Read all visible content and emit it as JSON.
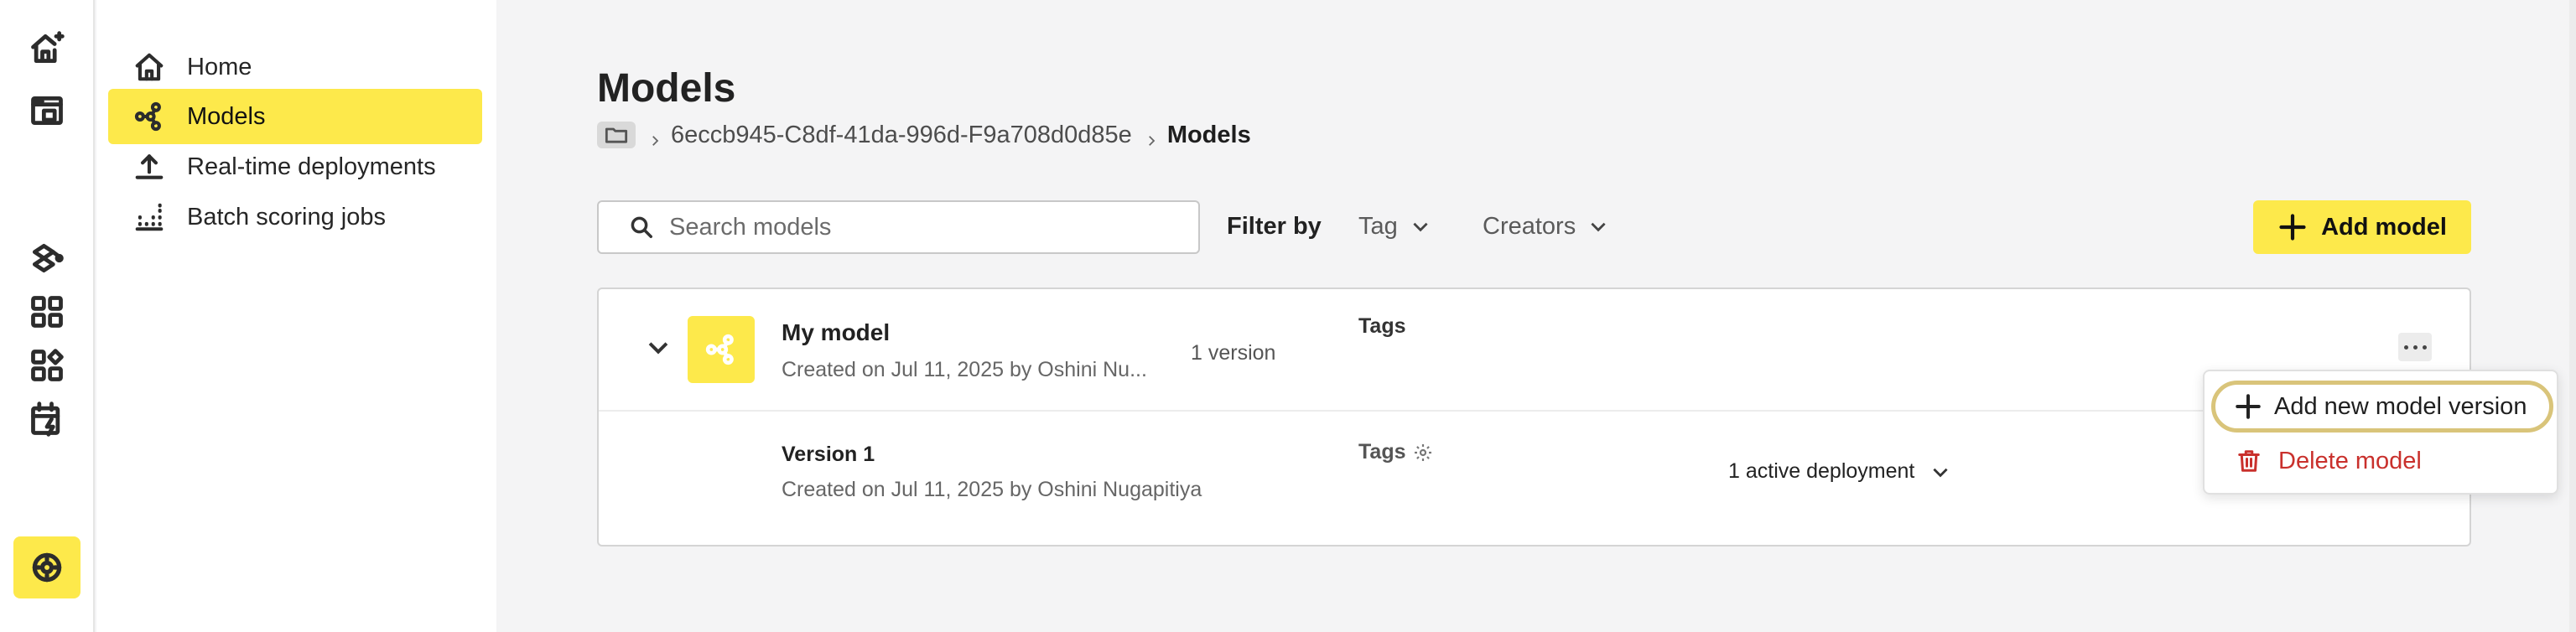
{
  "rail": {
    "icons": [
      "house-sparkle-icon",
      "store-icon",
      "puzzle-network-icon",
      "apps-grid-icon",
      "apps-add-icon",
      "calendar-bolt-icon"
    ],
    "bottom_icon": "brain-circuit-icon",
    "accent": "#fde94b"
  },
  "sidebar": {
    "items": [
      {
        "label": "Home",
        "icon": "home-icon"
      },
      {
        "label": "Models",
        "icon": "model-graph-icon",
        "active": true
      },
      {
        "label": "Real-time deployments",
        "icon": "upload-icon"
      },
      {
        "label": "Batch scoring jobs",
        "icon": "batch-grid-icon"
      }
    ]
  },
  "main": {
    "title": "Models",
    "breadcrumb": {
      "folder_icon": "folder-icon",
      "project": "6eccb945-C8df-41da-996d-F9a708d0d85e",
      "current": "Models"
    },
    "search": {
      "placeholder": "Search models",
      "value": ""
    },
    "filter": {
      "label": "Filter by",
      "tag": "Tag",
      "creators": "Creators"
    },
    "add_button": "Add model"
  },
  "model": {
    "name": "My model",
    "meta": "Created on Jul 11, 2025 by Oshini Nu...",
    "versions": "1 version",
    "tags_label": "Tags",
    "version": {
      "name": "Version 1",
      "meta": "Created on Jul 11, 2025 by Oshini Nugapitiya",
      "tags_label": "Tags",
      "deployments": "1 active deployment"
    }
  },
  "menu": {
    "add_version": "Add new model version",
    "delete": "Delete model",
    "delete_color": "#c9302c"
  }
}
